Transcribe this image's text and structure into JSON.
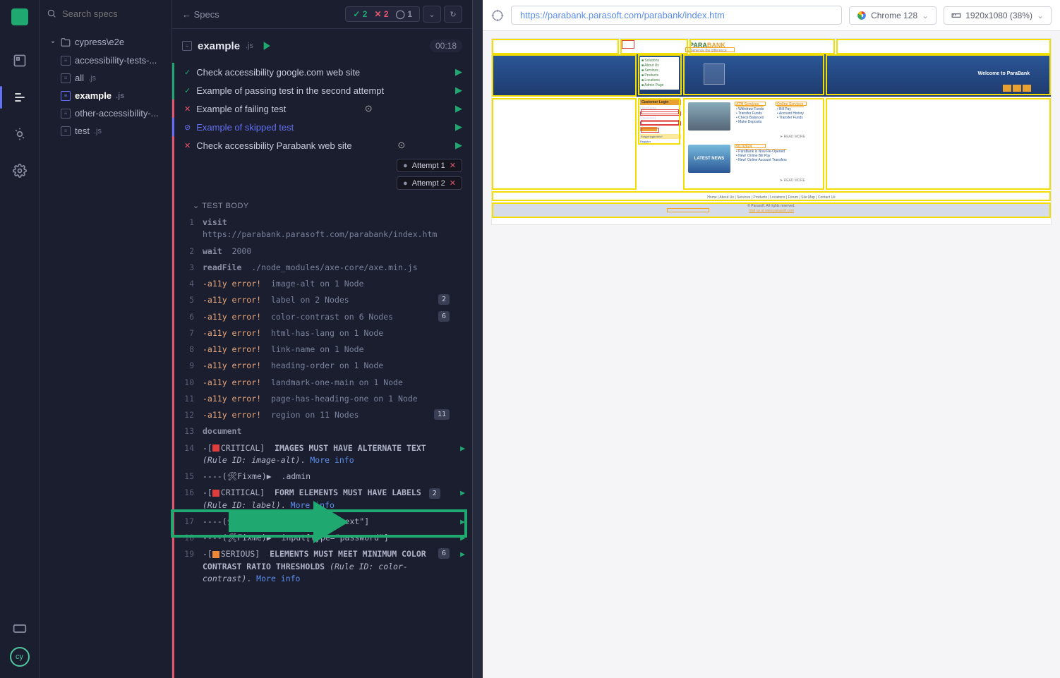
{
  "search_placeholder": "Search specs",
  "folder_name": "cypress\\e2e",
  "files": [
    {
      "name": "accessibility-tests-...",
      "ext": "",
      "active": false
    },
    {
      "name": "all",
      "ext": ".js",
      "active": false
    },
    {
      "name": "example",
      "ext": ".js",
      "active": true
    },
    {
      "name": "other-accessibility-...",
      "ext": "",
      "active": false
    },
    {
      "name": "test",
      "ext": ".js",
      "active": false
    }
  ],
  "specs_label": "Specs",
  "stats": {
    "pass": "2",
    "fail": "2",
    "pending": "1"
  },
  "spec_name": "example",
  "spec_ext": ".js",
  "spec_time": "00:18",
  "tests": [
    {
      "status": "pass",
      "text": "Check accessibility google.com web site"
    },
    {
      "status": "pass",
      "text": "Example of passing test in the second attempt"
    },
    {
      "status": "fail",
      "text": "Example of failing test",
      "warn": true
    },
    {
      "status": "skip",
      "text": "Example of skipped test"
    },
    {
      "status": "fail",
      "text": "Check accessibility Parabank web site",
      "warn": true
    }
  ],
  "attempts": [
    "Attempt 1",
    "Attempt 2"
  ],
  "test_body_label": "TEST BODY",
  "log": [
    {
      "n": "1",
      "cmd": "visit",
      "arg": "https://parabank.parasoft.com/parabank/index.htm"
    },
    {
      "n": "2",
      "cmd": "wait",
      "arg": "2000"
    },
    {
      "n": "3",
      "cmd": "readFile",
      "arg": "./node_modules/axe-core/axe.min.js"
    },
    {
      "n": "4",
      "cmd": "-a11y error!",
      "arg": "image-alt on 1 Node",
      "err": true
    },
    {
      "n": "5",
      "cmd": "-a11y error!",
      "arg": "label on 2 Nodes",
      "err": true,
      "badge": "2"
    },
    {
      "n": "6",
      "cmd": "-a11y error!",
      "arg": "color-contrast on 6 Nodes",
      "err": true,
      "badge": "6"
    },
    {
      "n": "7",
      "cmd": "-a11y error!",
      "arg": "html-has-lang on 1 Node",
      "err": true
    },
    {
      "n": "8",
      "cmd": "-a11y error!",
      "arg": "link-name on 1 Node",
      "err": true
    },
    {
      "n": "9",
      "cmd": "-a11y error!",
      "arg": "heading-order on 1 Node",
      "err": true
    },
    {
      "n": "10",
      "cmd": "-a11y error!",
      "arg": "landmark-one-main on 1 Node",
      "err": true
    },
    {
      "n": "11",
      "cmd": "-a11y error!",
      "arg": "page-has-heading-one on 1 Node",
      "err": true
    },
    {
      "n": "12",
      "cmd": "-a11y error!",
      "arg": "region on 11 Nodes",
      "err": true,
      "badge": "11"
    },
    {
      "n": "13",
      "cmd": "document",
      "arg": ""
    },
    {
      "n": "14",
      "raw": "-[<span class='crit-box'></span>CRITICAL]&nbsp; <b>IMAGES MUST HAVE ALTERNATE TEXT</b> <i>(Rule ID: image-alt)</i>. <span class='more-info'>More info</span>",
      "play": true
    },
    {
      "n": "15",
      "raw": "----(🛠Fixme)▶&nbsp; .admin"
    },
    {
      "n": "16",
      "raw": "-[<span class='crit-box'></span>CRITICAL]&nbsp; <b>FORM ELEMENTS MUST HAVE LABELS</b> <span class='log-badge'>2</span> <i>(Rule ID: label)</i>. <span class='more-info'>More info</span>",
      "play": true,
      "highlight": true
    },
    {
      "n": "17",
      "raw": "----(🛠Fixme)▶&nbsp; input[type=\"text\"]",
      "play": true
    },
    {
      "n": "18",
      "raw": "----(🛠Fixme)▶&nbsp; input[type=\"password\"]",
      "play": true
    },
    {
      "n": "19",
      "raw": "-[<span class='ser-box'></span>SERIOUS]&nbsp; <b>ELEMENTS MUST MEET MINIMUM COLOR CONTRAST RATIO THRESHOLDS</b> <i>(Rule ID: color-contrast)</i>. <span class='more-info'>More info</span>",
      "badge": "6",
      "play": true
    }
  ],
  "url": "https://parabank.parasoft.com/parabank/index.htm",
  "browser_label": "Chrome 128",
  "viewport_label": "1920x1080 (38%)",
  "site": {
    "brand_para": "PARA",
    "brand_bank": "BANK",
    "tagline": "Experience the difference",
    "left_menu": [
      "Solutions",
      "About Us",
      "Services",
      "Products",
      "Locations",
      "Admin Page"
    ],
    "welcome": "Welcome to ParaBank",
    "login_hdr": "Customer Login",
    "username": "Username",
    "password": "Password",
    "forgot": "Forgot login info?",
    "register": "Register",
    "atm_hdr": "ATM Services",
    "atm_items": [
      "Withdraw Funds",
      "Transfer Funds",
      "Check Balances",
      "Make Deposits"
    ],
    "online_hdr": "Online Services",
    "online_items": [
      "Bill Pay",
      "Account History",
      "Transfer Funds"
    ],
    "read_more": "READ MORE",
    "latest_hdr": "LATEST NEWS",
    "news_date": "9/17/2024",
    "news_items": [
      "ParaBank Is Now Re-Opened",
      "New! Online Bill Pay",
      "New! Online Account Transfers"
    ],
    "footer_nav": "Home  |  About Us  |  Services  |  Products  |  Locations  |  Forum  |  Site Map  |  Contact Us",
    "footer_copy": "© Parasoft. All rights reserved.",
    "footer_link": "Visit us at www.parasoft.com"
  }
}
